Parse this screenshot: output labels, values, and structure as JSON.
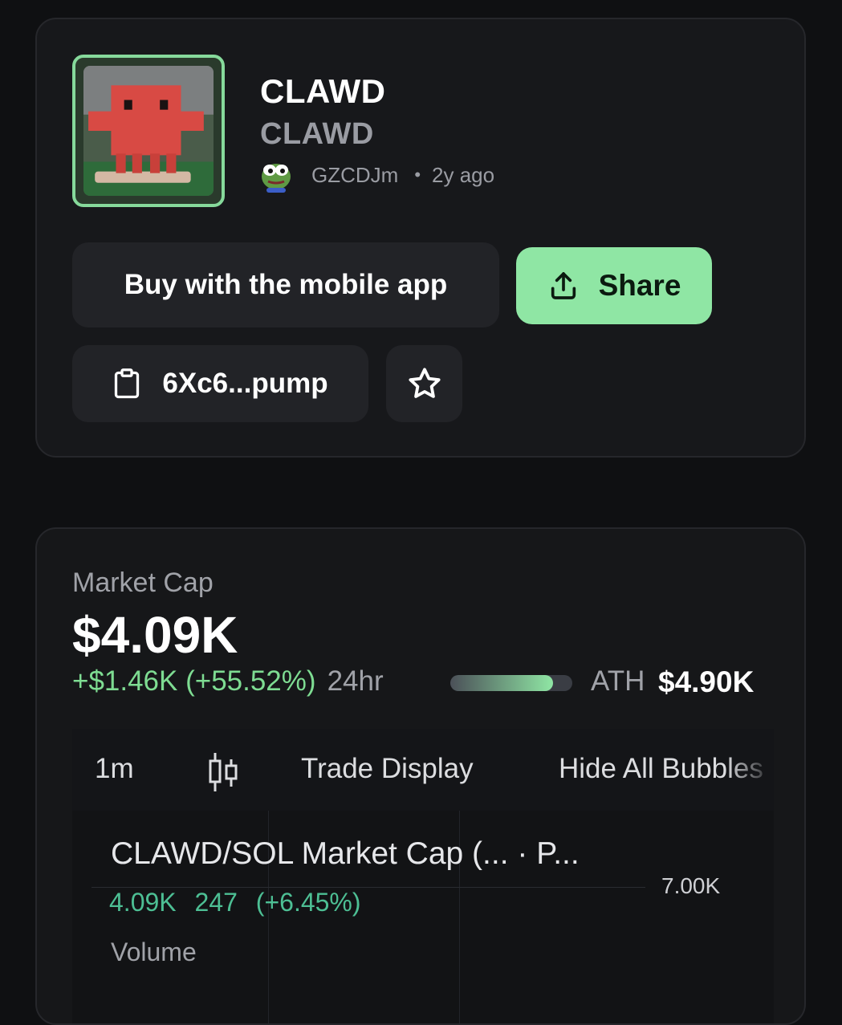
{
  "token": {
    "name": "CLAWD",
    "ticker": "CLAWD",
    "creator": "GZCDJm",
    "separator": "•",
    "age": "2y ago",
    "avatar_icon": "red-pixel-creature-image",
    "creator_icon": "frog-avatar-icon"
  },
  "actions": {
    "buy_label": "Buy with the mobile app",
    "share_label": "Share",
    "contract_label": "6Xc6...pump"
  },
  "market": {
    "label": "Market Cap",
    "value": "$4.09K",
    "change": "+$1.46K (+55.52%)",
    "period": "24hr",
    "ath_label": "ATH",
    "ath_value": "$4.90K",
    "ath_progress": 0.84
  },
  "chart": {
    "toolbar": {
      "interval": "1m",
      "trade_display": "Trade Display",
      "hide_bubbles": "Hide All Bubbles"
    },
    "title": "CLAWD/SOL Market Cap (... · P...",
    "stats": {
      "value": "4.09K",
      "change_abs": "247",
      "change_pct": "(+6.45%)"
    },
    "price_tick": "7.00K",
    "volume_label": "Volume"
  },
  "colors": {
    "accent_green": "#8fe6a4",
    "positive": "#7edc92",
    "chart_teal": "#4dbf94",
    "card_bg": "#17181b"
  }
}
